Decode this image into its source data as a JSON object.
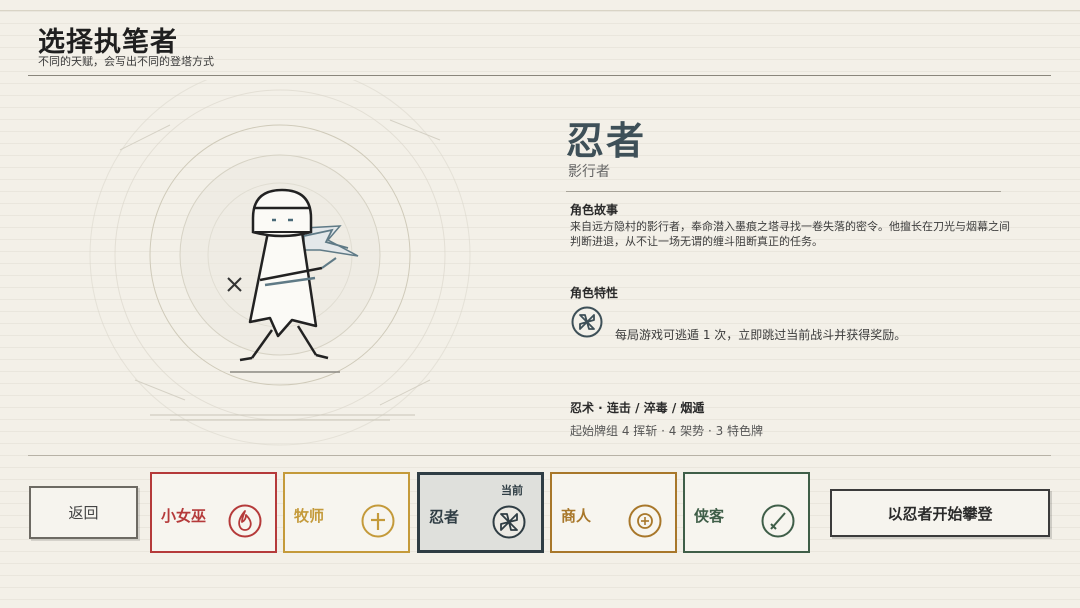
{
  "header": {
    "title": "选择执笔者",
    "subtitle": "不同的天赋，会写出不同的登塔方式"
  },
  "character": {
    "name": "忍者",
    "alias": "影行者",
    "story_heading": "角色故事",
    "story": "来自远方隐村的影行者，奉命潜入墨痕之塔寻找一卷失落的密令。他擅长在刀光与烟幕之间判断进退，从不让一场无谓的缠斗阻断真正的任务。",
    "trait_heading": "角色特性",
    "trait_icon": "shuriken-icon",
    "trait_text": "每局游戏可逃遁 1 次，立即跳过当前战斗并获得奖励。",
    "skills": "忍术 · 连击 / 淬毒 / 烟遁",
    "deck": "起始牌组 4 挥斩 · 4 架势 · 3 特色牌"
  },
  "colors": {
    "ink": "#2b2b2b",
    "ninja_slate": "#3e5058",
    "witch_red": "#b53a3a",
    "priest_gold": "#c49a3a",
    "merchant_brown": "#a8772a",
    "ranger_green": "#3f5e48"
  },
  "buttons": {
    "back": "返回",
    "start": "以忍者开始攀登"
  },
  "characters": [
    {
      "label": "小女巫",
      "icon": "flame-icon",
      "color": "#b53a3a",
      "selected": false
    },
    {
      "label": "牧师",
      "icon": "cross-icon",
      "color": "#c49a3a",
      "selected": false
    },
    {
      "label": "忍者",
      "icon": "shuriken-icon",
      "color": "#2f3d44",
      "selected": true,
      "badge": "当前"
    },
    {
      "label": "商人",
      "icon": "coin-icon",
      "color": "#a8772a",
      "selected": false
    },
    {
      "label": "侠客",
      "icon": "sword-icon",
      "color": "#3f5e48",
      "selected": false
    }
  ]
}
